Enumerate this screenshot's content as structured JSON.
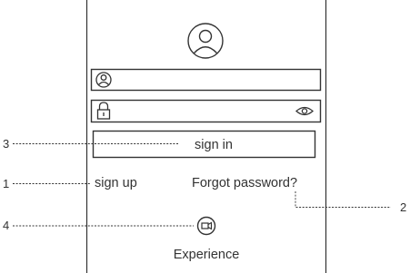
{
  "screen": {
    "sign_in_label": "sign in",
    "sign_up_label": "sign up",
    "forgot_password_label": "Forgot password?",
    "experience_label": "Experience",
    "icons": {
      "avatar": "user-circle-icon",
      "username_field": "user-icon",
      "password_field": "lock-icon",
      "toggle_password": "eye-icon",
      "experience": "video-camera-icon"
    }
  },
  "callouts": [
    {
      "number": "3"
    },
    {
      "number": "1"
    },
    {
      "number": "2"
    },
    {
      "number": "4"
    }
  ],
  "colors": {
    "line": "#333333",
    "text": "#333333",
    "background": "#ffffff"
  }
}
